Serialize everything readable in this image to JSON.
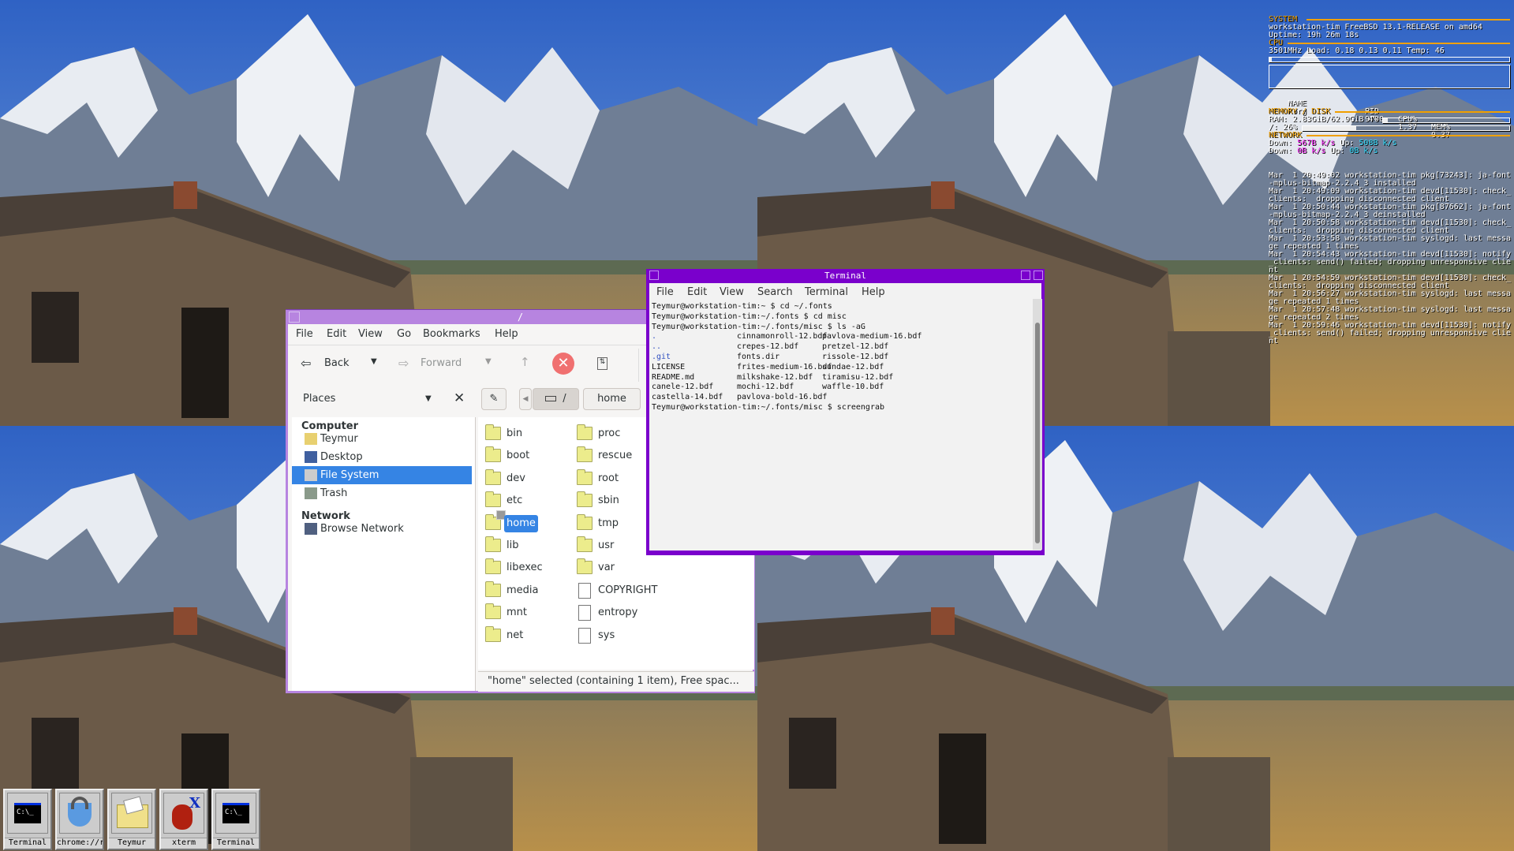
{
  "colors": {
    "terminal_frame": "#7a00cc",
    "filemanager_frame": "#b784e0",
    "selection": "#3584e4",
    "conky_header": "#f0a000",
    "conky_down": "#ff33ff",
    "conky_up": "#33ddff"
  },
  "file_manager": {
    "title": "/",
    "menu": [
      "File",
      "Edit",
      "View",
      "Go",
      "Bookmarks",
      "Help"
    ],
    "toolbar": {
      "back": "Back",
      "forward": "Forward",
      "icons": [
        "back-arrow-icon",
        "dropdown-icon",
        "forward-arrow-icon",
        "dropdown-icon",
        "up-arrow-icon",
        "stop-icon",
        "reload-icon"
      ]
    },
    "places_label": "Places",
    "path": [
      "/",
      "home"
    ],
    "sidebar": {
      "sections": [
        {
          "header": "Computer",
          "items": [
            {
              "label": "Teymur",
              "icon": "home-folder-icon"
            },
            {
              "label": "Desktop",
              "icon": "desktop-icon"
            },
            {
              "label": "File System",
              "icon": "drive-icon",
              "selected": true
            },
            {
              "label": "Trash",
              "icon": "trash-icon"
            }
          ]
        },
        {
          "header": "Network",
          "items": [
            {
              "label": "Browse Network",
              "icon": "network-icon"
            }
          ]
        }
      ]
    },
    "files_col1": [
      "bin",
      "boot",
      "dev",
      "etc",
      "home",
      "lib",
      "libexec",
      "media",
      "mnt",
      "net"
    ],
    "files_col2": [
      {
        "name": "proc",
        "type": "folder"
      },
      {
        "name": "rescue",
        "type": "folder"
      },
      {
        "name": "root",
        "type": "folder"
      },
      {
        "name": "sbin",
        "type": "folder"
      },
      {
        "name": "tmp",
        "type": "folder"
      },
      {
        "name": "usr",
        "type": "folder"
      },
      {
        "name": "var",
        "type": "folder"
      },
      {
        "name": "COPYRIGHT",
        "type": "file"
      },
      {
        "name": "entropy",
        "type": "file"
      },
      {
        "name": "sys",
        "type": "link"
      }
    ],
    "selected_file": "home",
    "status": "\"home\" selected (containing 1 item), Free spac..."
  },
  "terminal": {
    "title": "Terminal",
    "menu": [
      "File",
      "Edit",
      "View",
      "Search",
      "Terminal",
      "Help"
    ],
    "lines": [
      "Teymur@workstation-tim:~ $ cd ~/.fonts",
      "Teymur@workstation-tim:~/.fonts $ cd misc",
      "Teymur@workstation-tim:~/.fonts/misc $ ls -aG"
    ],
    "ls_rows": [
      [
        ".",
        "cinnamonroll-12.bdf",
        "pavlova-medium-16.bdf"
      ],
      [
        "..",
        "crepes-12.bdf",
        "pretzel-12.bdf"
      ],
      [
        ".git",
        "fonts.dir",
        "rissole-12.bdf"
      ],
      [
        "LICENSE",
        "frites-medium-16.bdf",
        "sundae-12.bdf"
      ],
      [
        "README.md",
        "milkshake-12.bdf",
        "tiramisu-12.bdf"
      ],
      [
        "canele-12.bdf",
        "mochi-12.bdf",
        "waffle-10.bdf"
      ],
      [
        "castella-14.bdf",
        "pavlova-bold-16.bdf",
        ""
      ]
    ],
    "last_line": "Teymur@workstation-tim:~/.fonts/misc $ screengrab"
  },
  "conky": {
    "system_header": "SYSTEM",
    "host": "workstation-tim FreeBSD 13.1-RELEASE on amd64",
    "uptime": "Uptime: 19h 26m 18s",
    "cpu_header": "CPU",
    "cpu": "3501MHz Load: 0.18 0.13 0.11 Temp: 46",
    "cpu_usage_percent": 1,
    "proc_headers": [
      "NAME",
      "PID",
      "CPU%",
      "MEM%"
    ],
    "proc": [
      "Xorg",
      "9700",
      "1.37",
      "0.37"
    ],
    "mem_header": "MEMORY / DISK",
    "ram": "RAM: 2.83GiB/62.9GiB 4%",
    "ram_percent": 4,
    "disk": "/: 26%",
    "disk_percent": 26,
    "net_header": "NETWORK",
    "net1": {
      "down_label": "Down: ",
      "down": "567B k/s",
      "up_label": " Up: ",
      "up": "508B k/s"
    },
    "net2": {
      "down_label": "Down: ",
      "down": "0B k/s",
      "up_label": " Up: ",
      "up": "0B k/s"
    },
    "log": [
      "Mar  1 20:49:02 workstation-tim pkg[73243]: ja-font-mplus-bitmap-2.2.4_3 installed",
      "Mar  1 20:49:09 workstation-tim devd[11530]: check_clients:  dropping disconnected client",
      "Mar  1 20:50:44 workstation-tim pkg[87662]: ja-font-mplus-bitmap-2.2.4_3 deinstalled",
      "Mar  1 20:50:58 workstation-tim devd[11530]: check_clients:  dropping disconnected client",
      "Mar  1 20:53:58 workstation-tim syslogd: last message repeated 1 times",
      "Mar  1 20:54:43 workstation-tim devd[11530]: notify_clients: send() failed; dropping unresponsive client",
      "Mar  1 20:54:59 workstation-tim devd[11530]: check_clients:  dropping disconnected client",
      "Mar  1 20:56:27 workstation-tim syslogd: last message repeated 1 times",
      "Mar  1 20:57:48 workstation-tim syslogd: last message repeated 2 times",
      "Mar  1 20:59:46 workstation-tim devd[11530]: notify_clients: send() failed; dropping unresponsive client"
    ]
  },
  "taskbar": [
    {
      "label": "Terminal",
      "icon": "terminal-icon"
    },
    {
      "label": "chrome://r",
      "icon": "chrome-lock-icon"
    },
    {
      "label": "Teymur",
      "icon": "folder-icon"
    },
    {
      "label": "xterm",
      "icon": "beastie-icon"
    },
    {
      "label": "Terminal",
      "icon": "terminal-icon"
    }
  ]
}
